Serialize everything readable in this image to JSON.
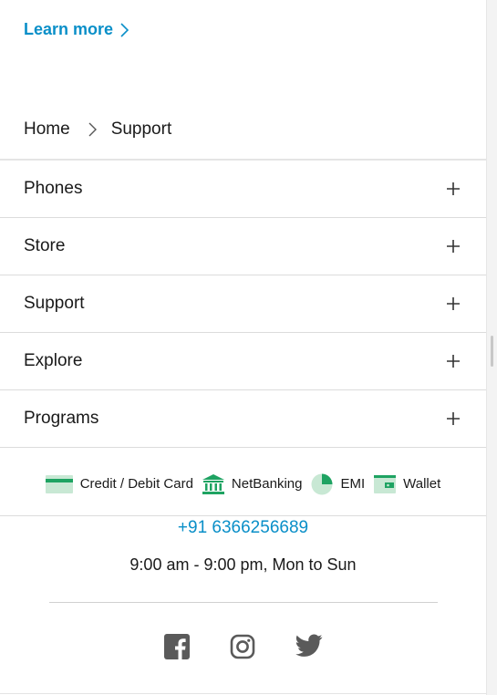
{
  "promo": {
    "learn_more_label": "Learn more"
  },
  "breadcrumb": {
    "home": "Home",
    "current": "Support"
  },
  "menu": {
    "items": [
      {
        "label": "Phones"
      },
      {
        "label": "Store"
      },
      {
        "label": "Support"
      },
      {
        "label": "Explore"
      },
      {
        "label": "Programs"
      }
    ]
  },
  "payments": {
    "card": "Credit / Debit Card",
    "netbanking": "NetBanking",
    "emi": "EMI",
    "wallet": "Wallet"
  },
  "contact": {
    "phone": "+91 6366256689",
    "hours": "9:00 am - 9:00 pm, Mon to Sun"
  },
  "social": [
    "facebook-icon",
    "instagram-icon",
    "twitter-icon"
  ],
  "colors": {
    "link": "#0a8fc8",
    "payment_icon_green": "#1ea362",
    "payment_icon_light": "#c8e8d4",
    "social_icon": "#5a5a5a"
  }
}
